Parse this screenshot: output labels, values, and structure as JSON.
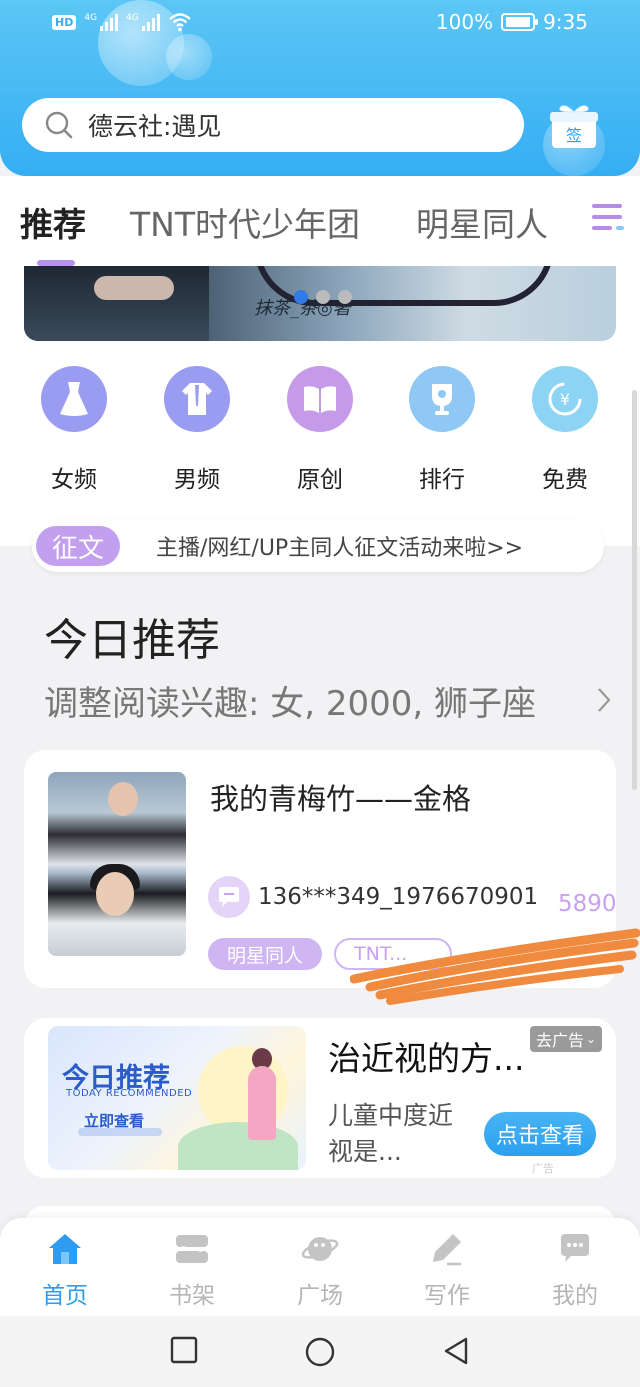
{
  "status_bar": {
    "hd": "HD",
    "network1": "4G",
    "network2": "4G",
    "battery_percent": "100%",
    "time": "9:35"
  },
  "search": {
    "value": "德云社:遇见",
    "gift_label": "签"
  },
  "tabs": [
    {
      "label": "推荐",
      "active": true
    },
    {
      "label": "TNT时代少年团",
      "active": false
    },
    {
      "label": "明星同人",
      "active": false
    }
  ],
  "banner": {
    "caption": "抹茶_茶◎著",
    "dots": 3,
    "active_dot": 0
  },
  "categories": [
    {
      "label": "女频",
      "icon": "dress-icon",
      "color": "#9a9cf2"
    },
    {
      "label": "男频",
      "icon": "shirt-icon",
      "color": "#9a9cf2"
    },
    {
      "label": "原创",
      "icon": "book-icon",
      "color": "#c59ae8"
    },
    {
      "label": "排行",
      "icon": "trophy-icon",
      "color": "#8fc8f5"
    },
    {
      "label": "免费",
      "icon": "yuan-icon",
      "color": "#8dd4f4"
    }
  ],
  "notice": {
    "tag": "征文",
    "text": "主播/网红/UP主同人征文活动来啦>>"
  },
  "today": {
    "title": "今日推荐",
    "subtitle": "调整阅读兴趣: 女, 2000, 狮子座"
  },
  "book": {
    "title": "我的青梅竹——金格",
    "author": "136***349_1976670901",
    "readers": "5890人",
    "tags": [
      "明星同人",
      "TNT..."
    ]
  },
  "ad": {
    "image_heading": "今日推荐",
    "image_en": "TODAY RECOMMENDED",
    "image_cta": "立即查看",
    "title": "治近视的方...",
    "close_label": "去广告",
    "description": "儿童中度近视是...",
    "button": "点击查看",
    "corner_label": "广告"
  },
  "bottom_nav": [
    {
      "label": "首页",
      "icon": "home-icon",
      "active": true
    },
    {
      "label": "书架",
      "icon": "bookshelf-icon",
      "active": false
    },
    {
      "label": "广场",
      "icon": "planet-icon",
      "active": false
    },
    {
      "label": "写作",
      "icon": "pen-icon",
      "active": false
    },
    {
      "label": "我的",
      "icon": "chat-icon",
      "active": false
    }
  ],
  "colors": {
    "header_blue": "#34aef3",
    "accent_purple": "#c6a2f0",
    "active_blue": "#2e9cf0"
  }
}
